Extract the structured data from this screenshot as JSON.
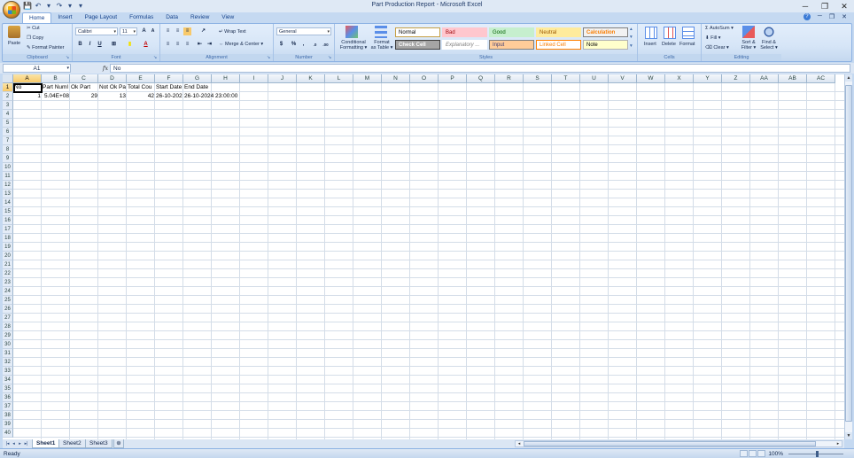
{
  "app": {
    "title": "Part Production Report - Microsoft Excel",
    "window_controls": [
      "─",
      "❐",
      "✕"
    ],
    "ribbon_controls": [
      "?",
      "─",
      "❐",
      "✕"
    ]
  },
  "qat": [
    "💾",
    "↶",
    "▾",
    "↷",
    "▾",
    "▾"
  ],
  "tabs": [
    "Home",
    "Insert",
    "Page Layout",
    "Formulas",
    "Data",
    "Review",
    "View"
  ],
  "ribbon": {
    "clipboard": {
      "label": "Clipboard",
      "paste": "Paste",
      "cut": "Cut",
      "copy": "Copy",
      "format_painter": "Format Painter"
    },
    "font": {
      "label": "Font",
      "name": "Calibri",
      "size": "11",
      "grow": "A",
      "shrink": "A",
      "bold": "B",
      "italic": "I",
      "underline": "U",
      "border": "⊞",
      "fill": "▮",
      "color": "A"
    },
    "alignment": {
      "label": "Alignment",
      "wrap_text": "Wrap Text",
      "merge_center": "Merge & Center",
      "align_icons": [
        "≡",
        "≡",
        "≡",
        "≡",
        "≡",
        "≡",
        "⇤",
        "⇥",
        "↗"
      ]
    },
    "number": {
      "label": "Number",
      "format": "General",
      "currency": "$",
      "percent": "%",
      "comma": ",",
      "inc_decimal": ".0",
      "dec_decimal": ".00"
    },
    "styles": {
      "label": "Styles",
      "conditional_formatting": [
        "Conditional",
        "Formatting ▾"
      ],
      "format_as_table": [
        "Format",
        "as Table ▾"
      ],
      "cells": [
        {
          "text": "Normal",
          "bg": "#ffffff",
          "fg": "#000000",
          "border": "#c6a046"
        },
        {
          "text": "Bad",
          "bg": "#ffc7ce",
          "fg": "#9c0006",
          "border": "#ffc7ce"
        },
        {
          "text": "Good",
          "bg": "#c6efce",
          "fg": "#006100",
          "border": "#c6efce"
        },
        {
          "text": "Neutral",
          "bg": "#ffeb9c",
          "fg": "#9c5700",
          "border": "#ffeb9c"
        },
        {
          "text": "Calculation",
          "bg": "#f2f2f2",
          "fg": "#fa7d00",
          "border": "#7f7f7f"
        },
        {
          "text": "Check Cell",
          "bg": "#a5a5a5",
          "fg": "#ffffff",
          "border": "#3f3f3f"
        },
        {
          "text": "Explanatory ...",
          "bg": "#ffffff",
          "fg": "#7f7f7f",
          "border": "#ffffff"
        },
        {
          "text": "Input",
          "bg": "#ffcc99",
          "fg": "#3f3f76",
          "border": "#7f7f7f"
        },
        {
          "text": "Linked Cell",
          "bg": "#ffffff",
          "fg": "#fa7d00",
          "border": "#ff8001"
        },
        {
          "text": "Note",
          "bg": "#ffffcc",
          "fg": "#000000",
          "border": "#b2b2b2"
        }
      ],
      "more": [
        "▴",
        "▾",
        "▾"
      ]
    },
    "cells_group": {
      "label": "Cells",
      "insert": "Insert",
      "delete": "Delete",
      "format": "Format"
    },
    "editing": {
      "label": "Editing",
      "autosum": "AutoSum ▾",
      "fill": "Fill ▾",
      "clear": "Clear ▾",
      "sort_filter": [
        "Sort &",
        "Filter ▾"
      ],
      "find_select": [
        "Find &",
        "Select ▾"
      ]
    }
  },
  "formula_bar": {
    "name_box": "A1",
    "fx": "fx",
    "content": "No"
  },
  "grid": {
    "columns": [
      "A",
      "B",
      "C",
      "D",
      "E",
      "F",
      "G",
      "H",
      "I",
      "J",
      "K",
      "L",
      "M",
      "N",
      "O",
      "P",
      "Q",
      "R",
      "S",
      "T",
      "U",
      "V",
      "W",
      "X",
      "Y",
      "Z",
      "AA",
      "AB",
      "AC"
    ],
    "rows": [
      "1",
      "2",
      "3",
      "4",
      "5",
      "6",
      "7",
      "8",
      "9",
      "10",
      "11",
      "12",
      "13",
      "14",
      "15",
      "16",
      "17",
      "18",
      "19",
      "20",
      "21",
      "22",
      "23",
      "24",
      "25",
      "26",
      "27",
      "28",
      "29",
      "30",
      "31",
      "32",
      "33",
      "34",
      "35",
      "36",
      "37",
      "38",
      "39",
      "40"
    ],
    "cells": [
      {
        "col": "A",
        "row": "1",
        "text": "No",
        "num": false
      },
      {
        "col": "B",
        "row": "1",
        "text": "Part Numl",
        "num": false
      },
      {
        "col": "C",
        "row": "1",
        "text": "Ok Part",
        "num": false
      },
      {
        "col": "D",
        "row": "1",
        "text": "Not Ok Pa",
        "num": false
      },
      {
        "col": "E",
        "row": "1",
        "text": "Total Cou",
        "num": false
      },
      {
        "col": "F",
        "row": "1",
        "text": "Start Date",
        "num": false
      },
      {
        "col": "G",
        "row": "1",
        "text": "End Date",
        "num": false
      },
      {
        "col": "A",
        "row": "2",
        "text": "1",
        "num": true
      },
      {
        "col": "B",
        "row": "2",
        "text": "5.04E+08",
        "num": true
      },
      {
        "col": "C",
        "row": "2",
        "text": "29",
        "num": true
      },
      {
        "col": "D",
        "row": "2",
        "text": "13",
        "num": true
      },
      {
        "col": "E",
        "row": "2",
        "text": "42",
        "num": true
      },
      {
        "col": "F",
        "row": "2",
        "text": "26-10-202",
        "num": false
      },
      {
        "col": "G",
        "row": "2",
        "text": "26-10-2024 23:00:00",
        "num": false
      }
    ]
  },
  "sheets": [
    "Sheet1",
    "Sheet2",
    "Sheet3"
  ],
  "sheet_nav": [
    "|◂",
    "◂",
    "▸",
    "▸|"
  ],
  "status": {
    "text": "Ready",
    "zoom": "100%"
  }
}
